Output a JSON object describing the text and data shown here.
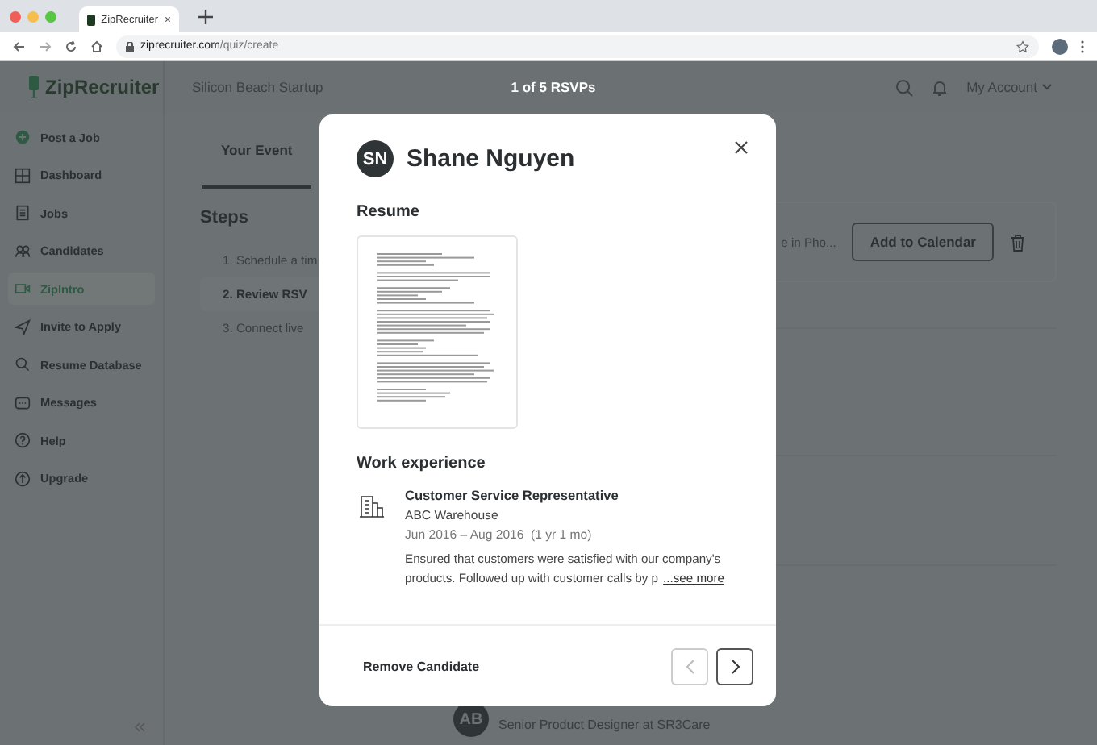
{
  "browser": {
    "tab_title": "ZipRecruiter",
    "url_host": "ziprecruiter.com",
    "url_path": "/quiz/create"
  },
  "header": {
    "logo": "ZipRecruiter",
    "workspace": "Silicon Beach Startup",
    "counter": "1 of 5 RSVPs",
    "account": "My Account"
  },
  "sidebar": {
    "items": [
      {
        "label": "Post a Job",
        "selected": false
      },
      {
        "label": "Dashboard",
        "selected": false
      },
      {
        "label": "Jobs",
        "selected": false
      },
      {
        "label": "Candidates",
        "selected": false
      },
      {
        "label": "ZipIntro",
        "selected": true
      },
      {
        "label": "Invite to Apply",
        "selected": false
      },
      {
        "label": "Resume Database",
        "selected": false
      },
      {
        "label": "Messages",
        "selected": false
      },
      {
        "label": "Help",
        "selected": false
      },
      {
        "label": "Upgrade",
        "selected": false
      }
    ]
  },
  "event": {
    "tabs": [
      {
        "label": "Your Event",
        "selected": true
      }
    ],
    "steps_title": "Steps",
    "steps": [
      {
        "label": "1. Schedule a tim",
        "selected": false
      },
      {
        "label": "2. Review RSV",
        "selected": true
      },
      {
        "label": "3. Connect live",
        "selected": false
      }
    ],
    "card_text": "e in Pho...",
    "card_button": "Add to Calendar"
  },
  "candidate_behind": {
    "initials": "AB",
    "headline": "Senior Product Designer at SR3Care"
  },
  "modal": {
    "initials": "SN",
    "name": "Shane Nguyen",
    "resume_heading": "Resume",
    "work_heading": "Work experience",
    "experience": [
      {
        "title": "Customer Service Representative",
        "company": "ABC Warehouse",
        "dates": "Jun 2016 – Aug 2016  (1 yr 1 mo)",
        "description": "Ensured that customers were satisfied with our company's products. Followed up with customer calls by p",
        "more": "...see more"
      }
    ],
    "remove_button": "Remove Candidate",
    "prev": {
      "disabled": true
    },
    "next": {
      "disabled": false
    }
  }
}
